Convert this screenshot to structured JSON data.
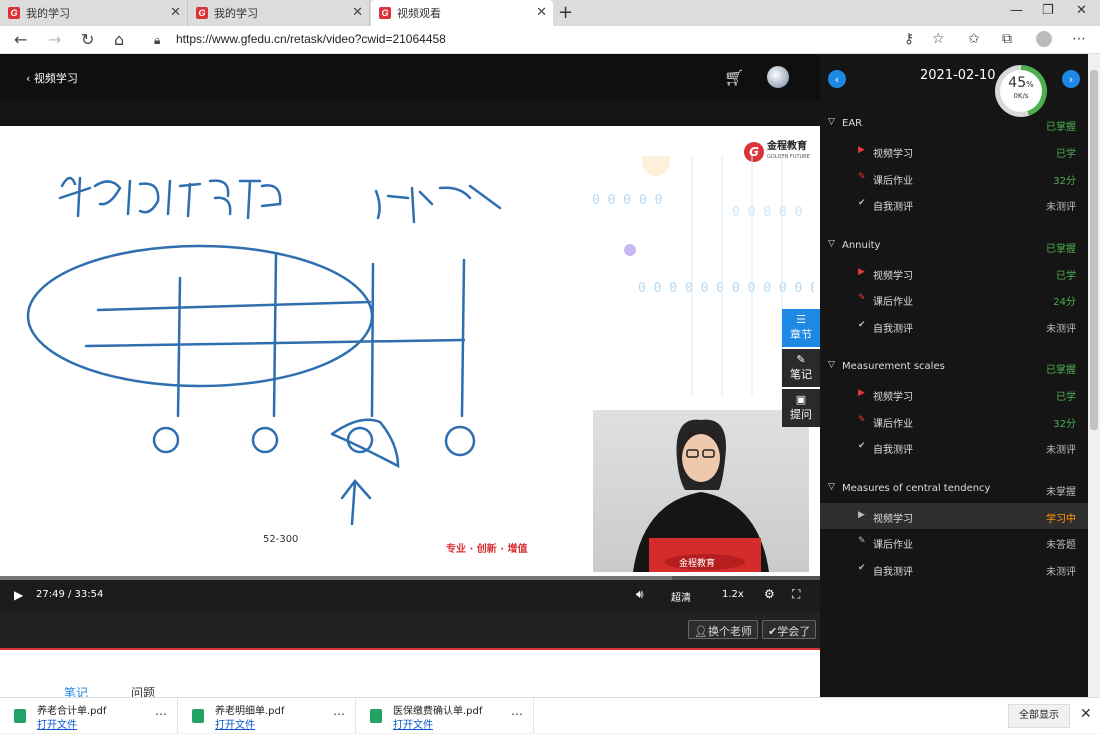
{
  "browser": {
    "tabs": [
      {
        "label": "我的学习"
      },
      {
        "label": "我的学习"
      },
      {
        "label": "视频观看"
      }
    ],
    "url": "https://www.gfedu.cn/retask/video?cwid=21064458"
  },
  "player": {
    "back_label": "视频学习",
    "page_number": "52-300",
    "slogan": "专业 · 创新 · 增值",
    "brand_name": "金程教育",
    "brand_sub": "GOLDEN FUTURE",
    "time": "27:49 / 33:54",
    "progress_fraction": 0.82,
    "quality": "超清",
    "speed": "1.2x",
    "side_tools": [
      {
        "label": "章节"
      },
      {
        "label": "笔记"
      },
      {
        "label": "提问"
      }
    ],
    "switch_teacher": "换个老师",
    "learned": "学会了"
  },
  "notes_tabs": [
    {
      "label": "笔记"
    },
    {
      "label": "问题"
    }
  ],
  "sidebar": {
    "date": "2021-02-10",
    "gauge": {
      "percent": "45",
      "unit": "%",
      "speed": "0K/s",
      "value": 0.45
    },
    "sections": [
      {
        "title": "EAR",
        "status": "已掌握",
        "items": [
          {
            "label": "视频学习",
            "status": "已学"
          },
          {
            "label": "课后作业",
            "status": "32分"
          },
          {
            "label": "自我测评",
            "status": "未测评"
          }
        ]
      },
      {
        "title": "Annuity",
        "status": "已掌握",
        "items": [
          {
            "label": "视频学习",
            "status": "已学"
          },
          {
            "label": "课后作业",
            "status": "24分"
          },
          {
            "label": "自我测评",
            "status": "未测评"
          }
        ]
      },
      {
        "title": "Measurement scales",
        "status": "已掌握",
        "items": [
          {
            "label": "视频学习",
            "status": "已学"
          },
          {
            "label": "课后作业",
            "status": "32分"
          },
          {
            "label": "自我测评",
            "status": "未测评"
          }
        ]
      },
      {
        "title": "Measures of central tendency",
        "status": "未掌握",
        "items": [
          {
            "label": "视频学习",
            "status": "学习中"
          },
          {
            "label": "课后作业",
            "status": "未答题"
          },
          {
            "label": "自我测评",
            "status": "未测评"
          }
        ]
      }
    ]
  },
  "downloads": {
    "items": [
      {
        "name": "养老合计单.pdf",
        "action": "打开文件"
      },
      {
        "name": "养老明细单.pdf",
        "action": "打开文件"
      },
      {
        "name": "医保缴费确认单.pdf",
        "action": "打开文件"
      }
    ],
    "show_all": "全部显示"
  },
  "colors": {
    "accent": "#1e88e5",
    "brand": "#d9343a",
    "mastered": "#4caf50",
    "in_progress": "#ff9800"
  }
}
